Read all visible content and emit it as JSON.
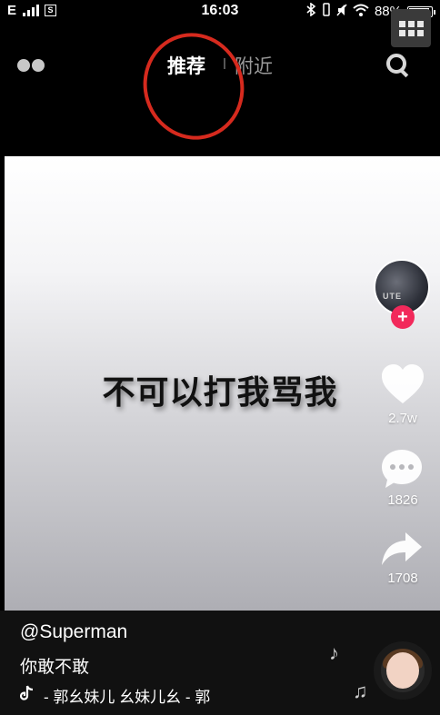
{
  "status": {
    "carrier": "E",
    "sim_label": "S",
    "time": "16:03",
    "battery": "88%"
  },
  "header": {
    "tabs": [
      {
        "label": "推荐",
        "active": true
      },
      {
        "label": "附近",
        "active": false
      }
    ]
  },
  "video": {
    "caption": "不可以打我骂我"
  },
  "sidebar": {
    "likes": "2.7w",
    "comments": "1826",
    "shares": "1708"
  },
  "footer": {
    "username": "@Superman",
    "description": "你敢不敢",
    "music": "- 郭幺妹儿    幺妹儿幺 - 郭"
  },
  "colors": {
    "annotation_circle": "#d62a1e",
    "follow_button": "#f2295b"
  },
  "icons": [
    "menu-dots-icon",
    "search-icon",
    "grid-menu-icon",
    "heart-icon",
    "comment-icon",
    "share-icon",
    "tiktok-note-icon",
    "music-note-icon"
  ]
}
